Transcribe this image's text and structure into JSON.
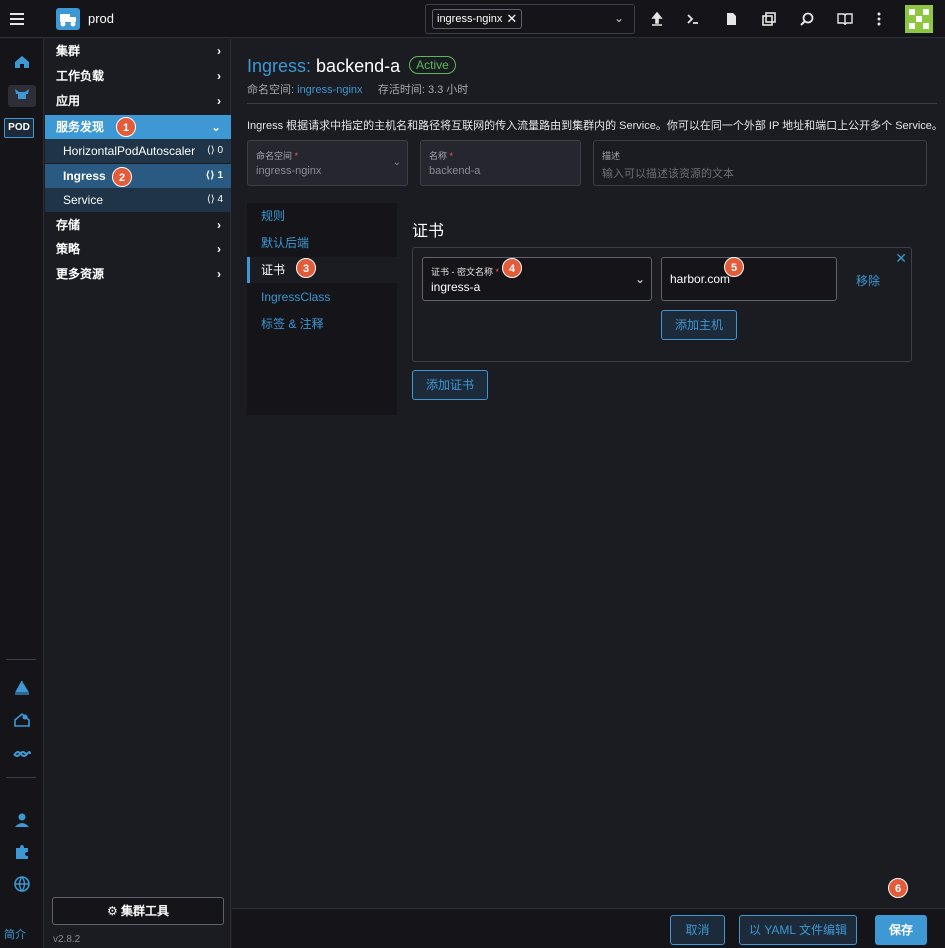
{
  "topbar": {
    "cluster_name": "prod",
    "namespace_chip": "ingress-nginx"
  },
  "rail": {
    "pod_label": "POD",
    "about_label": "简介"
  },
  "sidenav": {
    "groups": [
      {
        "label": "集群"
      },
      {
        "label": "工作负载"
      },
      {
        "label": "应用"
      },
      {
        "label": "服务发现"
      },
      {
        "label": "存储"
      },
      {
        "label": "策略"
      },
      {
        "label": "更多资源"
      }
    ],
    "children": [
      {
        "label": "HorizontalPodAutoscaler",
        "count": "0"
      },
      {
        "label": "Ingress",
        "count": "1"
      },
      {
        "label": "Service",
        "count": "4"
      }
    ],
    "cluster_tools": "集群工具",
    "version": "v2.8.2"
  },
  "header": {
    "kind": "Ingress:",
    "name": "backend-a",
    "status": "Active",
    "namespace_label": "命名空间:",
    "namespace_value": "ingress-nginx",
    "age_label": "存活时间: 3.3 小时",
    "description": "Ingress 根据请求中指定的主机名和路径将互联网的传入流量路由到集群内的 Service。你可以在同一个外部 IP 地址和端口上公开多个 Service。"
  },
  "fields": {
    "namespace": {
      "label": "命名空间",
      "value": "ingress-nginx"
    },
    "name": {
      "label": "名称",
      "value": "backend-a"
    },
    "description": {
      "label": "描述",
      "placeholder": "输入可以描述该资源的文本"
    }
  },
  "tabs": [
    {
      "label": "规则"
    },
    {
      "label": "默认后端"
    },
    {
      "label": "证书"
    },
    {
      "label": "IngressClass"
    },
    {
      "label": "标签 & 注释"
    }
  ],
  "cert_panel": {
    "title": "证书",
    "secret_label": "证书 - 密文名称",
    "secret_value": "ingress-a",
    "host_value": "harbor.com",
    "remove_label": "移除",
    "add_host_label": "添加主机",
    "add_cert_label": "添加证书"
  },
  "footer": {
    "cancel": "取消",
    "edit_yaml": "以 YAML 文件编辑",
    "save": "保存"
  },
  "steps": [
    "1",
    "2",
    "3",
    "4",
    "5",
    "6"
  ]
}
